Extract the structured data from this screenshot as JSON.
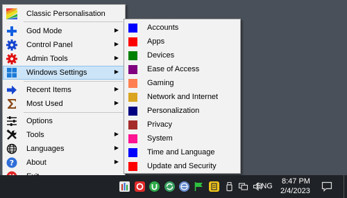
{
  "main_menu": {
    "items": [
      {
        "label": "Classic Personalisation",
        "icon": "rainbow-square-icon"
      },
      {
        "label": "God Mode",
        "icon": "blue-cross-icon"
      },
      {
        "label": "Control Panel",
        "icon": "blue-gear-icon"
      },
      {
        "label": "Admin Tools",
        "icon": "red-gear-icon"
      },
      {
        "label": "Windows Settings",
        "icon": "windows-logo-icon"
      },
      {
        "label": "Recent Items",
        "icon": "blue-arrow-icon"
      },
      {
        "label": "Most Used",
        "icon": "sigma-icon"
      },
      {
        "label": "Options",
        "icon": "sliders-icon"
      },
      {
        "label": "Tools",
        "icon": "tools-icon"
      },
      {
        "label": "Languages",
        "icon": "globe-icon"
      },
      {
        "label": "About",
        "icon": "help-icon"
      },
      {
        "label": "Exit",
        "icon": "exit-icon"
      }
    ],
    "highlighted": "Windows Settings"
  },
  "sub_menu": {
    "items": [
      {
        "label": "Accounts",
        "color": "#0000ff"
      },
      {
        "label": "Apps",
        "color": "#ff0000"
      },
      {
        "label": "Devices",
        "color": "#008000"
      },
      {
        "label": "Ease of Access",
        "color": "#800080"
      },
      {
        "label": "Gaming",
        "color": "#ff7f50"
      },
      {
        "label": "Network and Internet",
        "color": "#daa520"
      },
      {
        "label": "Personalization",
        "color": "#000080"
      },
      {
        "label": "Privacy",
        "color": "#a52a2a"
      },
      {
        "label": "System",
        "color": "#ff1493"
      },
      {
        "label": "Time and Language",
        "color": "#0000ff"
      },
      {
        "label": "Update and Security",
        "color": "#ff0000"
      }
    ]
  },
  "taskbar": {
    "language": "ENG",
    "time": "8:47 PM",
    "date": "2/4/2023",
    "colors": {
      "background": "#1f2226",
      "desktop": "#4a5059"
    }
  }
}
